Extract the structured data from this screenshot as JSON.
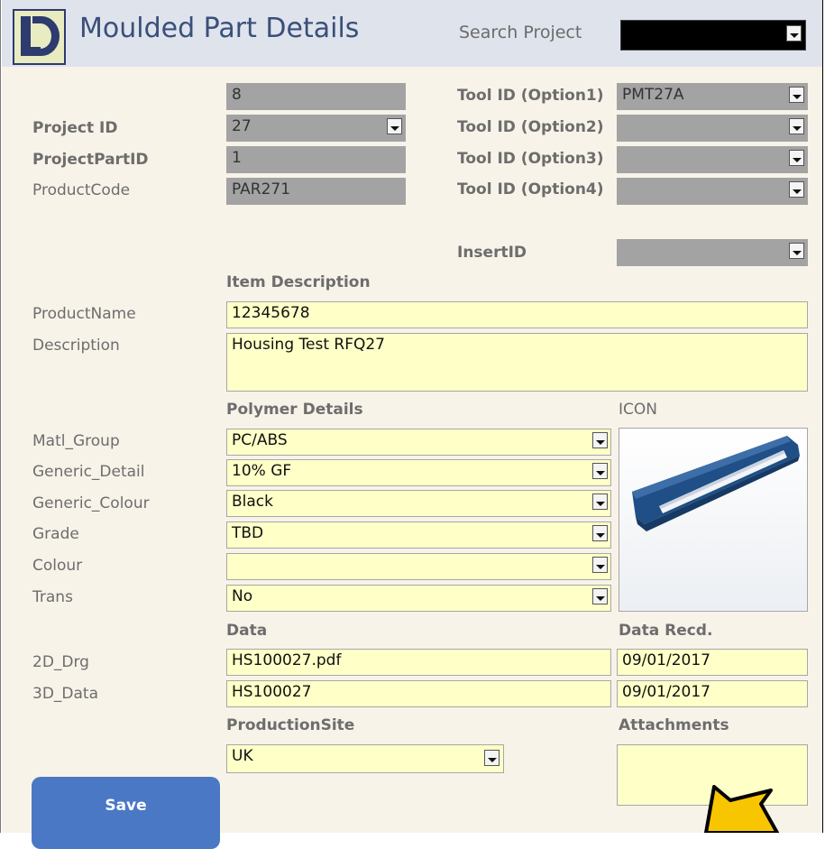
{
  "header": {
    "title": "Moulded Part Details",
    "search_label": "Search Project",
    "search_value": ""
  },
  "ids": {
    "id_value": "8",
    "project_id_label": "Project ID",
    "project_id_value": "27",
    "project_part_id_label": "ProjectPartID",
    "project_part_id_value": "1",
    "product_code_label": "ProductCode",
    "product_code_value": "PAR271"
  },
  "tools": {
    "option1_label": "Tool ID (Option1)",
    "option1_value": "PMT27A",
    "option2_label": "Tool ID (Option2)",
    "option2_value": "",
    "option3_label": "Tool ID (Option3)",
    "option3_value": "",
    "option4_label": "Tool ID (Option4)",
    "option4_value": "",
    "insert_label": "InsertID",
    "insert_value": ""
  },
  "item": {
    "section_title": "Item Description",
    "product_name_label": "ProductName",
    "product_name_value": "12345678",
    "description_label": "Description",
    "description_value": "Housing Test RFQ27"
  },
  "polymer": {
    "section_title": "Polymer Details",
    "icon_label": "ICON",
    "matl_group_label": "Matl_Group",
    "matl_group_value": "PC/ABS",
    "generic_detail_label": "Generic_Detail",
    "generic_detail_value": "10% GF",
    "generic_colour_label": "Generic_Colour",
    "generic_colour_value": "Black",
    "grade_label": "Grade",
    "grade_value": "TBD",
    "colour_label": "Colour",
    "colour_value": "",
    "trans_label": "Trans",
    "trans_value": "No"
  },
  "data_section": {
    "section_title": "Data",
    "recd_title": "Data Recd.",
    "drg2d_label": "2D_Drg",
    "drg2d_value": "HS100027.pdf",
    "drg2d_date": "09/01/2017",
    "data3d_label": "3D_Data",
    "data3d_value": "HS100027",
    "data3d_date": "09/01/2017"
  },
  "production": {
    "section_title": "ProductionSite",
    "site_value": "UK",
    "attachments_title": "Attachments"
  },
  "actions": {
    "save_label": "Save"
  },
  "colors": {
    "header_bg": "#dfe3ec",
    "form_bg": "#f8f3e9",
    "title_color": "#3a4f7a",
    "input_yellow": "#ffffc8",
    "locked_gray": "#a3a3a3",
    "save_blue": "#4a78c5",
    "cursor_yellow": "#f7c600"
  },
  "icons": {
    "logo": "ld-logo",
    "dropdown": "chevron-down-icon",
    "part_thumbnail": "moulded-part-thumbnail",
    "pointer": "arrow-cursor-icon"
  }
}
